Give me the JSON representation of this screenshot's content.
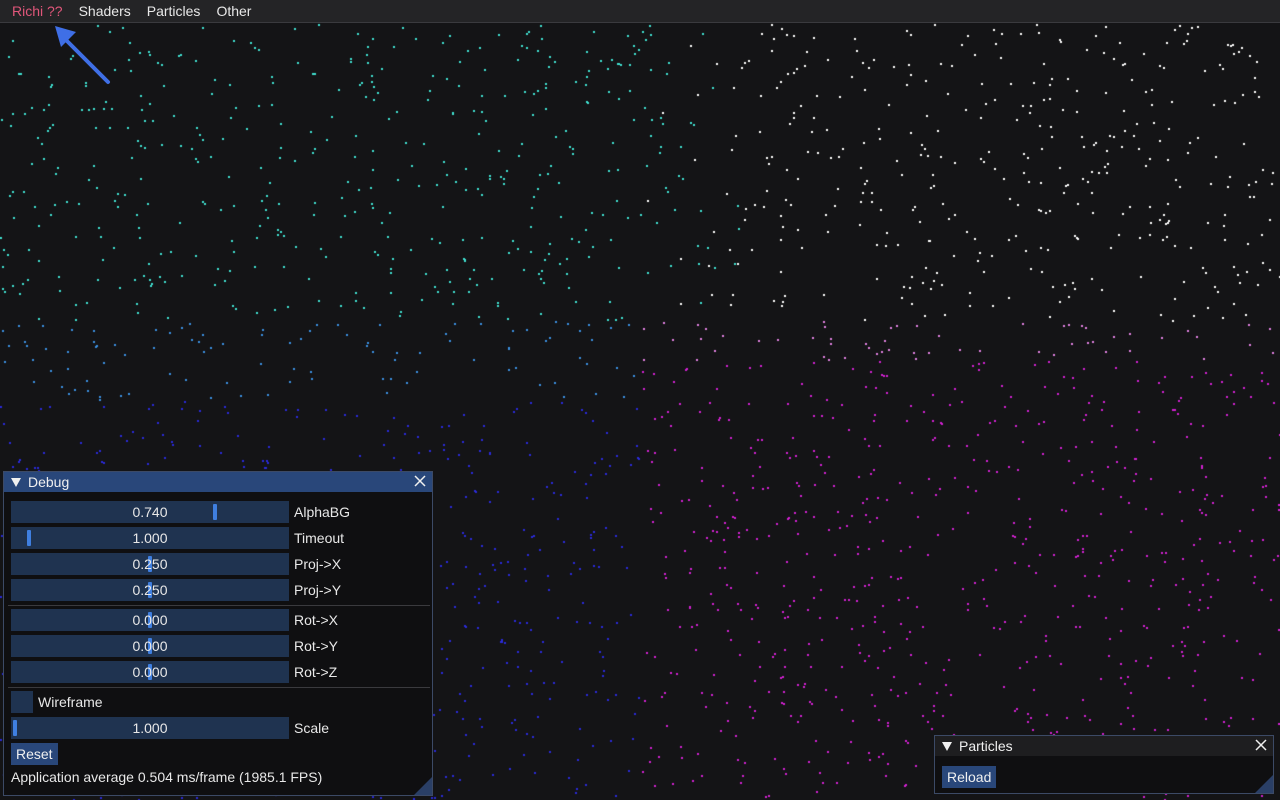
{
  "menu": {
    "items": [
      "Richi ??",
      "Shaders",
      "Particles",
      "Other"
    ]
  },
  "colors": {
    "accent": "#29477a",
    "menu_active": "#e0567a",
    "slider_bg": "#1f3350",
    "grab": "#3f7fe0",
    "background": "#141416"
  },
  "debug_window": {
    "title": "Debug",
    "close_icon": "close-icon",
    "collapse_icon": "triangle-down-icon",
    "sliders": [
      {
        "value": "0.740",
        "label": "AlphaBG",
        "grab_fraction": 0.74
      },
      {
        "value": "1.000",
        "label": "Timeout",
        "grab_fraction": 0.05
      },
      {
        "value": "0.250",
        "label": "Proj->X",
        "grab_fraction": 0.5
      },
      {
        "value": "0.250",
        "label": "Proj->Y",
        "grab_fraction": 0.5
      },
      {
        "value": "0.000",
        "label": "Rot->X",
        "grab_fraction": 0.5
      },
      {
        "value": "0.000",
        "label": "Rot->Y",
        "grab_fraction": 0.5
      },
      {
        "value": "0.000",
        "label": "Rot->Z",
        "grab_fraction": 0.5
      }
    ],
    "wireframe": {
      "label": "Wireframe",
      "checked": false
    },
    "scale": {
      "value": "1.000",
      "label": "Scale",
      "grab_fraction": 0.0
    },
    "reset_label": "Reset",
    "status": "Application average 0.504 ms/frame (1985.1 FPS)"
  },
  "particles_window": {
    "title": "Particles",
    "reload_label": "Reload"
  }
}
